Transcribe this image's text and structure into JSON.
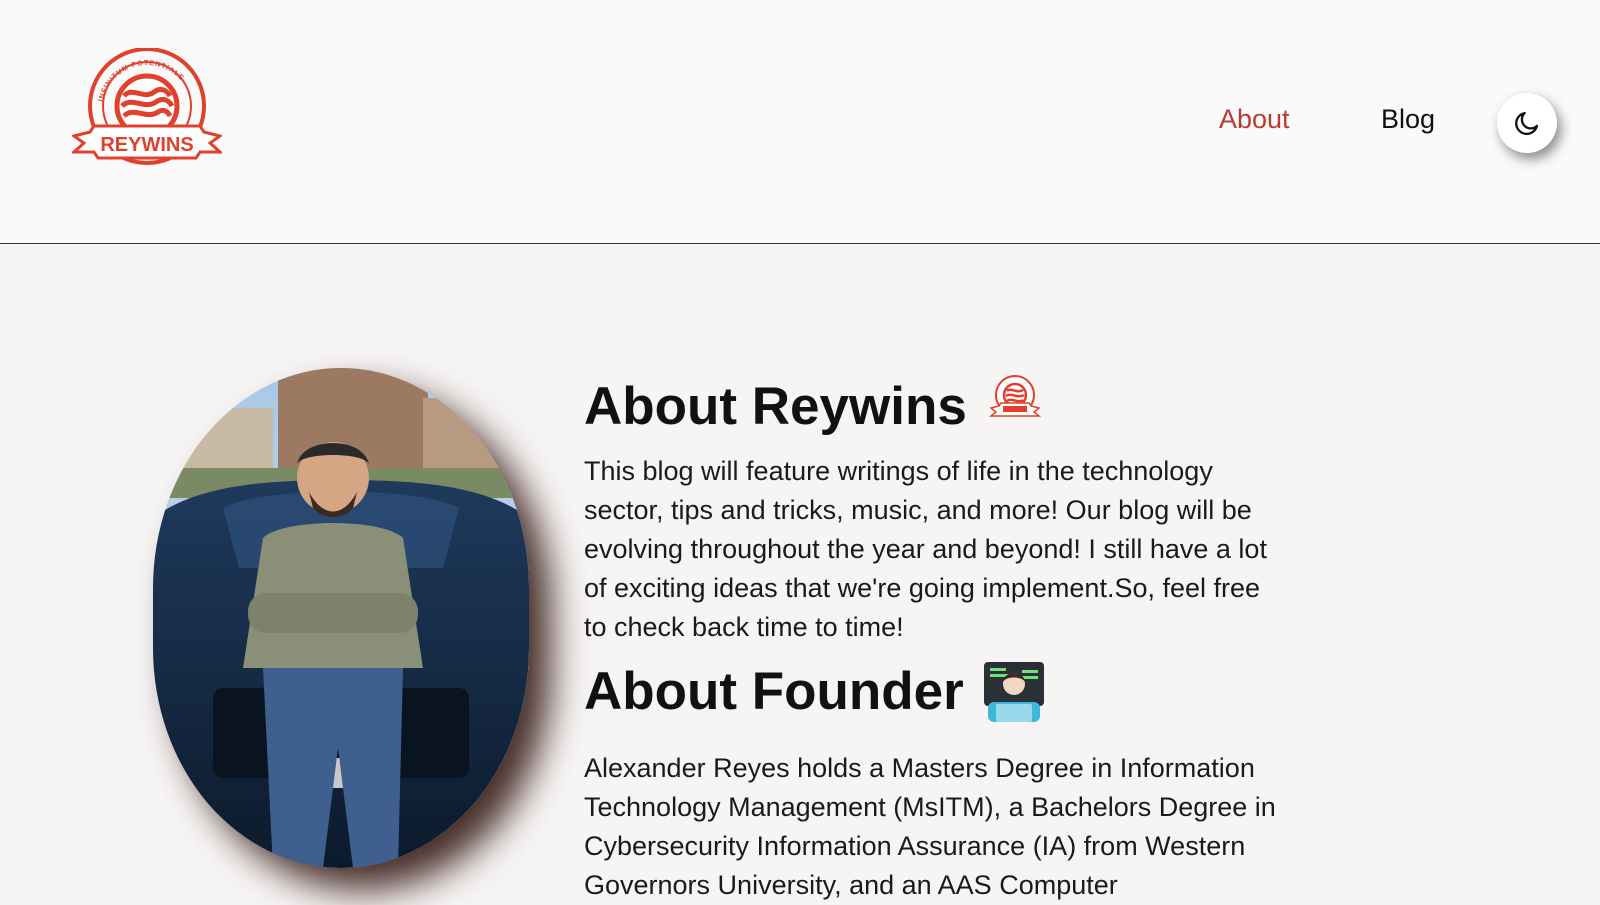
{
  "header": {
    "logo": {
      "brand_text": "REYWINS",
      "tagline": "INFINITUM POTENTIALE",
      "icon": "reywins-logo"
    },
    "nav": [
      {
        "label": "About",
        "active": true,
        "color": "#b83a30"
      },
      {
        "label": "Blog",
        "active": false
      }
    ],
    "theme_toggle_icon": "moon-icon"
  },
  "main": {
    "photo_icon": "founder-photo",
    "about_reywins": {
      "title": "About Reywins",
      "badge_icon": "reywins-logo",
      "body": "This blog will feature writings of life in the technology sector, tips and tricks, music, and more! Our blog will be evolving throughout the year and beyond! I still have a lot of exciting ideas that we're going implement.So, feel free to check back time to time!"
    },
    "about_founder": {
      "title": "About Founder",
      "emoji": "technologist-emoji",
      "body": "Alexander Reyes holds a Masters Degree in Information Technology Management (MsITM), a Bachelors Degree in Cybersecurity Information Assurance (IA) from Western Governors University, and an AAS Computer"
    }
  },
  "colors": {
    "accent": "#b83a30",
    "logo_red": "#e0402c",
    "page_bg": "#f7f5f4",
    "header_bg": "#fbfafa"
  }
}
